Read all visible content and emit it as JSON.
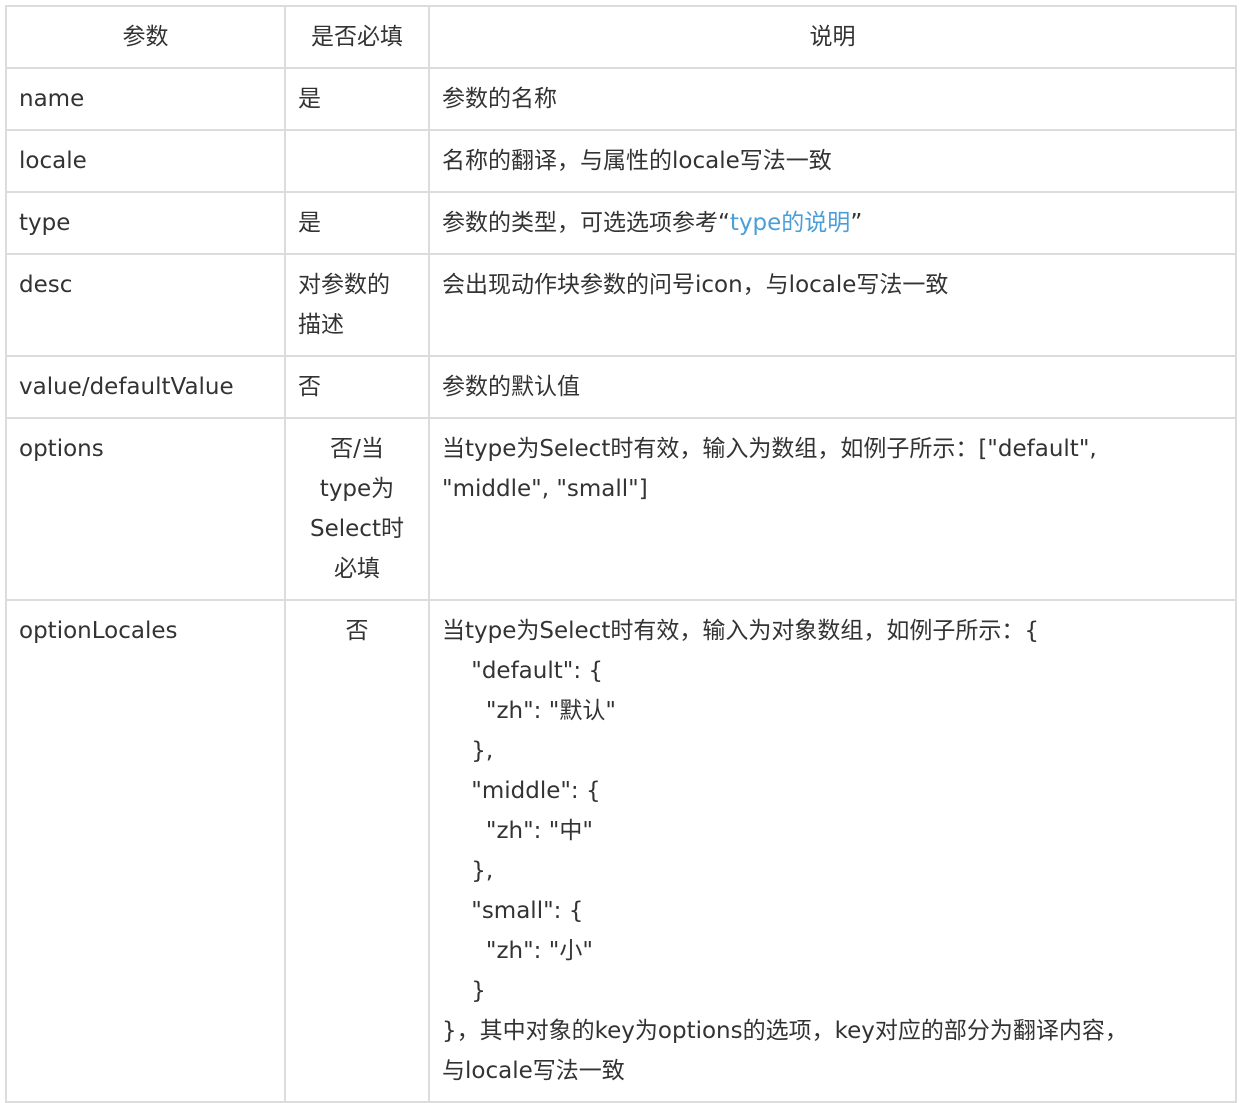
{
  "headers": [
    "参数",
    "是否必填",
    "说明"
  ],
  "rows": [
    {
      "param": "name",
      "required": "是",
      "desc": "参数的名称"
    },
    {
      "param": "locale",
      "required": "",
      "desc": "名称的翻译，与属性的locale写法一致"
    },
    {
      "param": "type",
      "required": "是",
      "desc_prefix": "参数的类型，可选选项参考“",
      "desc_link": "type的说明",
      "desc_suffix": "”"
    },
    {
      "param": "desc",
      "required_lines": [
        "对参数的",
        "描述"
      ],
      "desc": "会出现动作块参数的问号icon，与locale写法一致"
    },
    {
      "param": "value/defaultValue",
      "required": "否",
      "desc": "参数的默认值"
    },
    {
      "param": "options",
      "required_lines": [
        "否/当",
        "type为",
        "Select时",
        "必填"
      ],
      "desc_lines": [
        "当type为Select时有效，输入为数组，如例子所示：[\"default\",",
        "\"middle\", \"small\"]"
      ]
    },
    {
      "param": "optionLocales",
      "required": "否",
      "desc_lines": [
        "当type为Select时有效，输入为对象数组，如例子所示：{",
        "    \"default\": {",
        "      \"zh\": \"默认\"",
        "    },",
        "    \"middle\": {",
        "      \"zh\": \"中\"",
        "    },",
        "    \"small\": {",
        "      \"zh\": \"小\"",
        "    }",
        "}，其中对象的key为options的选项，key对应的部分为翻译内容，",
        "与locale写法一致"
      ]
    }
  ],
  "colors": {
    "border": "#dcdcdc",
    "text": "#333333",
    "link": "#4a9fd8"
  }
}
